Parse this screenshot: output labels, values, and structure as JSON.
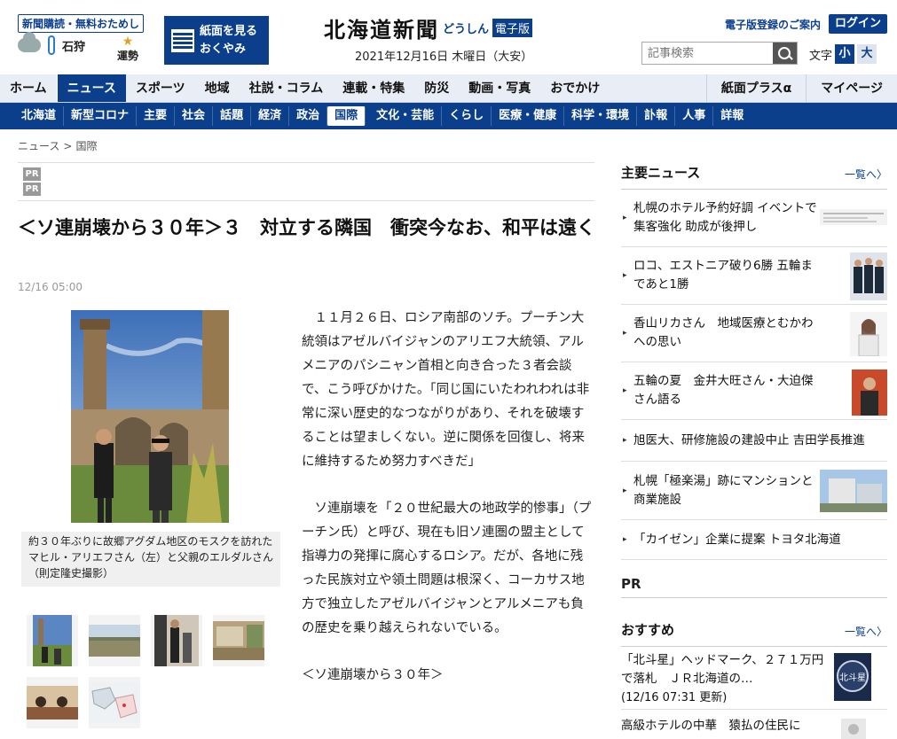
{
  "header": {
    "promo": "新聞購読・無料おためし",
    "weather_city": "石狩",
    "fortune": "運勢",
    "shimen_line1": "紙面を見る",
    "shimen_line2": "おくやみ",
    "logo_main": "北海道新聞",
    "logo_sub": "どうしん",
    "logo_edition": "電子版",
    "date": "2021年12月16日 木曜日（大安）",
    "register": "電子版登録のご案内",
    "login": "ログイン",
    "search_placeholder": "記事検索",
    "font_label": "文字",
    "font_small": "小",
    "font_large": "大"
  },
  "nav1": {
    "items": [
      "ホーム",
      "ニュース",
      "スポーツ",
      "地域",
      "社説・コラム",
      "連載・特集",
      "防災",
      "動画・写真",
      "おでかけ"
    ],
    "right": [
      "紙面プラスα",
      "マイページ"
    ]
  },
  "nav2": {
    "items": [
      "北海道",
      "新型コロナ",
      "主要",
      "社会",
      "話題",
      "経済",
      "政治",
      "国際",
      "文化・芸能",
      "くらし",
      "医療・健康",
      "科学・環境",
      "訃報",
      "人事",
      "詳報"
    ]
  },
  "breadcrumb": [
    "ニュース",
    "国際"
  ],
  "pr_label": "PR",
  "article": {
    "title": "＜ソ連崩壊から３０年＞３　対立する隣国　衝突今なお、和平は遠く",
    "time": "12/16 05:00",
    "caption": "約３０年ぶりに故郷アグダム地区のモスクを訪れたマヒル・アリエフさん（左）と父親のエルダルさん（則定隆史撮影）",
    "paragraphs": [
      "１１月２６日、ロシア南部のソチ。プーチン大統領はアゼルバイジャンのアリエフ大統領、アルメニアのパシニャン首相と向き合った３者会談で、こう呼びかけた。「同じ国にいたわれわれは非常に深い歴史的なつながりがあり、それを破壊することは望ましくない。逆に関係を回復し、将来に維持するため努力すべきだ」",
      "ソ連崩壊を「２０世紀最大の地政学的惨事」（プーチン氏）と呼び、現在も旧ソ連圏の盟主として指導力の発揮に腐心するロシア。だが、各地に残った民族対立や領土問題は根深く、コーカサス地方で独立したアゼルバイジャンとアルメニアも負の歴史を乗り越えられないでいる。"
    ],
    "subhead": "＜ソ連崩壊から３０年＞"
  },
  "sidebar": {
    "main_news_title": "主要ニュース",
    "more": "一覧へ",
    "news": [
      "札幌のホテル予約好調 イベントで集客強化 助成が後押し",
      "ロコ、エストニア破り6勝 五輪まであと1勝",
      "香山リカさん　地域医療とむかわへの思い",
      "五輪の夏　金井大旺さん・大迫傑さん語る",
      "旭医大、研修施設の建設中止 吉田学長推進",
      "札幌「極楽湯」跡にマンションと商業施設",
      "「カイゼン」企業に提案 トヨタ北海道"
    ],
    "pr": "PR",
    "recommend_title": "おすすめ",
    "recommend": [
      "「北斗星」ヘッドマーク、２７１万円で落札　ＪＲ北海道の…",
      "(12/16 07:31 更新)",
      "高級ホテルの中華　猿払の住民に"
    ],
    "hokutosei_text": "北斗星"
  }
}
